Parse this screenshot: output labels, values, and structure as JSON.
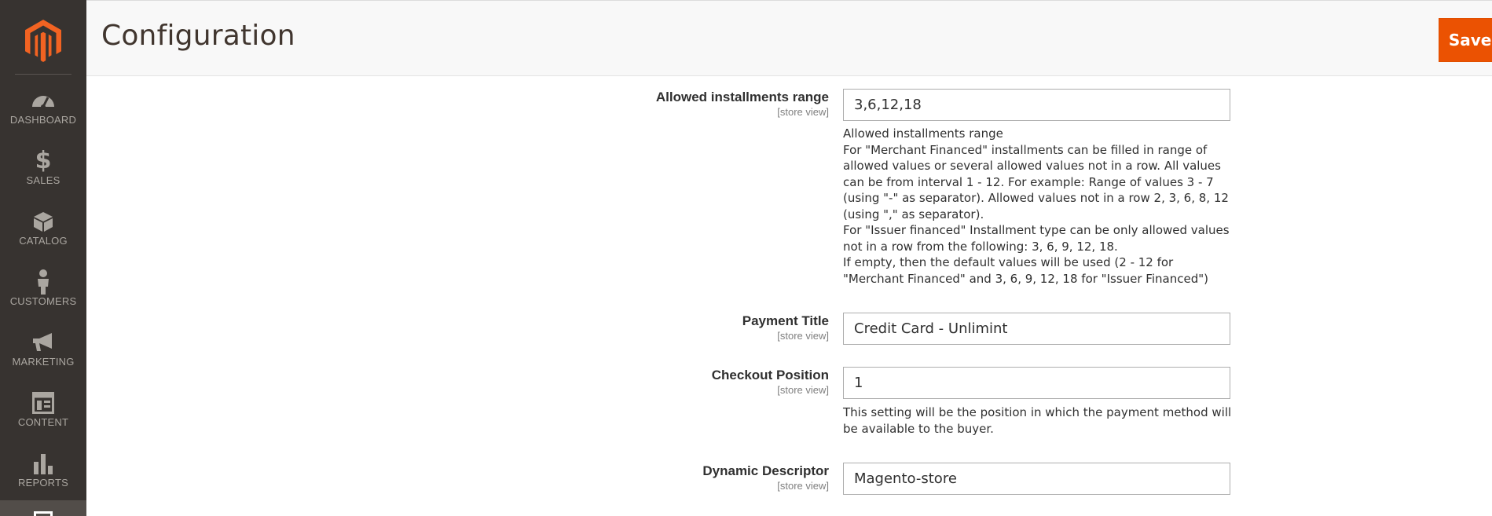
{
  "header": {
    "title": "Configuration",
    "save_label": "Save Config"
  },
  "sidebar": {
    "items": [
      {
        "label": "DASHBOARD",
        "icon": "dashboard-icon"
      },
      {
        "label": "SALES",
        "icon": "dollar-icon"
      },
      {
        "label": "CATALOG",
        "icon": "box-icon"
      },
      {
        "label": "CUSTOMERS",
        "icon": "person-icon"
      },
      {
        "label": "MARKETING",
        "icon": "megaphone-icon"
      },
      {
        "label": "CONTENT",
        "icon": "layout-icon"
      },
      {
        "label": "REPORTS",
        "icon": "bar-chart-icon"
      }
    ]
  },
  "fields": {
    "installments": {
      "label": "Allowed installments range",
      "scope": "[store view]",
      "value": "3,6,12,18",
      "note": [
        "Allowed installments range",
        "For \"Merchant Financed\" installments can be filled in range of allowed values or several allowed values not in a row. All values can be from interval 1 - 12. For example: Range of values 3 - 7 (using \"-\" as separator). Allowed values not in a row 2, 3, 6, 8, 12 (using \",\" as separator).",
        "For \"Issuer financed\" Installment type can be only allowed values not in a row from the following: 3, 6, 9, 12, 18.",
        "If empty, then the default values will be used (2 - 12 for \"Merchant Financed\" and 3, 6, 9, 12, 18 for \"Issuer Financed\")"
      ]
    },
    "payment_title": {
      "label": "Payment Title",
      "scope": "[store view]",
      "value": "Credit Card - Unlimint"
    },
    "checkout_position": {
      "label": "Checkout Position",
      "scope": "[store view]",
      "value": "1",
      "note": "This setting will be the position in which the payment method will be available to the buyer."
    },
    "dynamic_descriptor": {
      "label": "Dynamic Descriptor",
      "scope": "[store view]",
      "value": "Magento-store"
    }
  },
  "colors": {
    "accent": "#eb5202",
    "sidebar_bg": "#373330",
    "nav_text": "#aaa6a0",
    "logo": "#f26322"
  }
}
